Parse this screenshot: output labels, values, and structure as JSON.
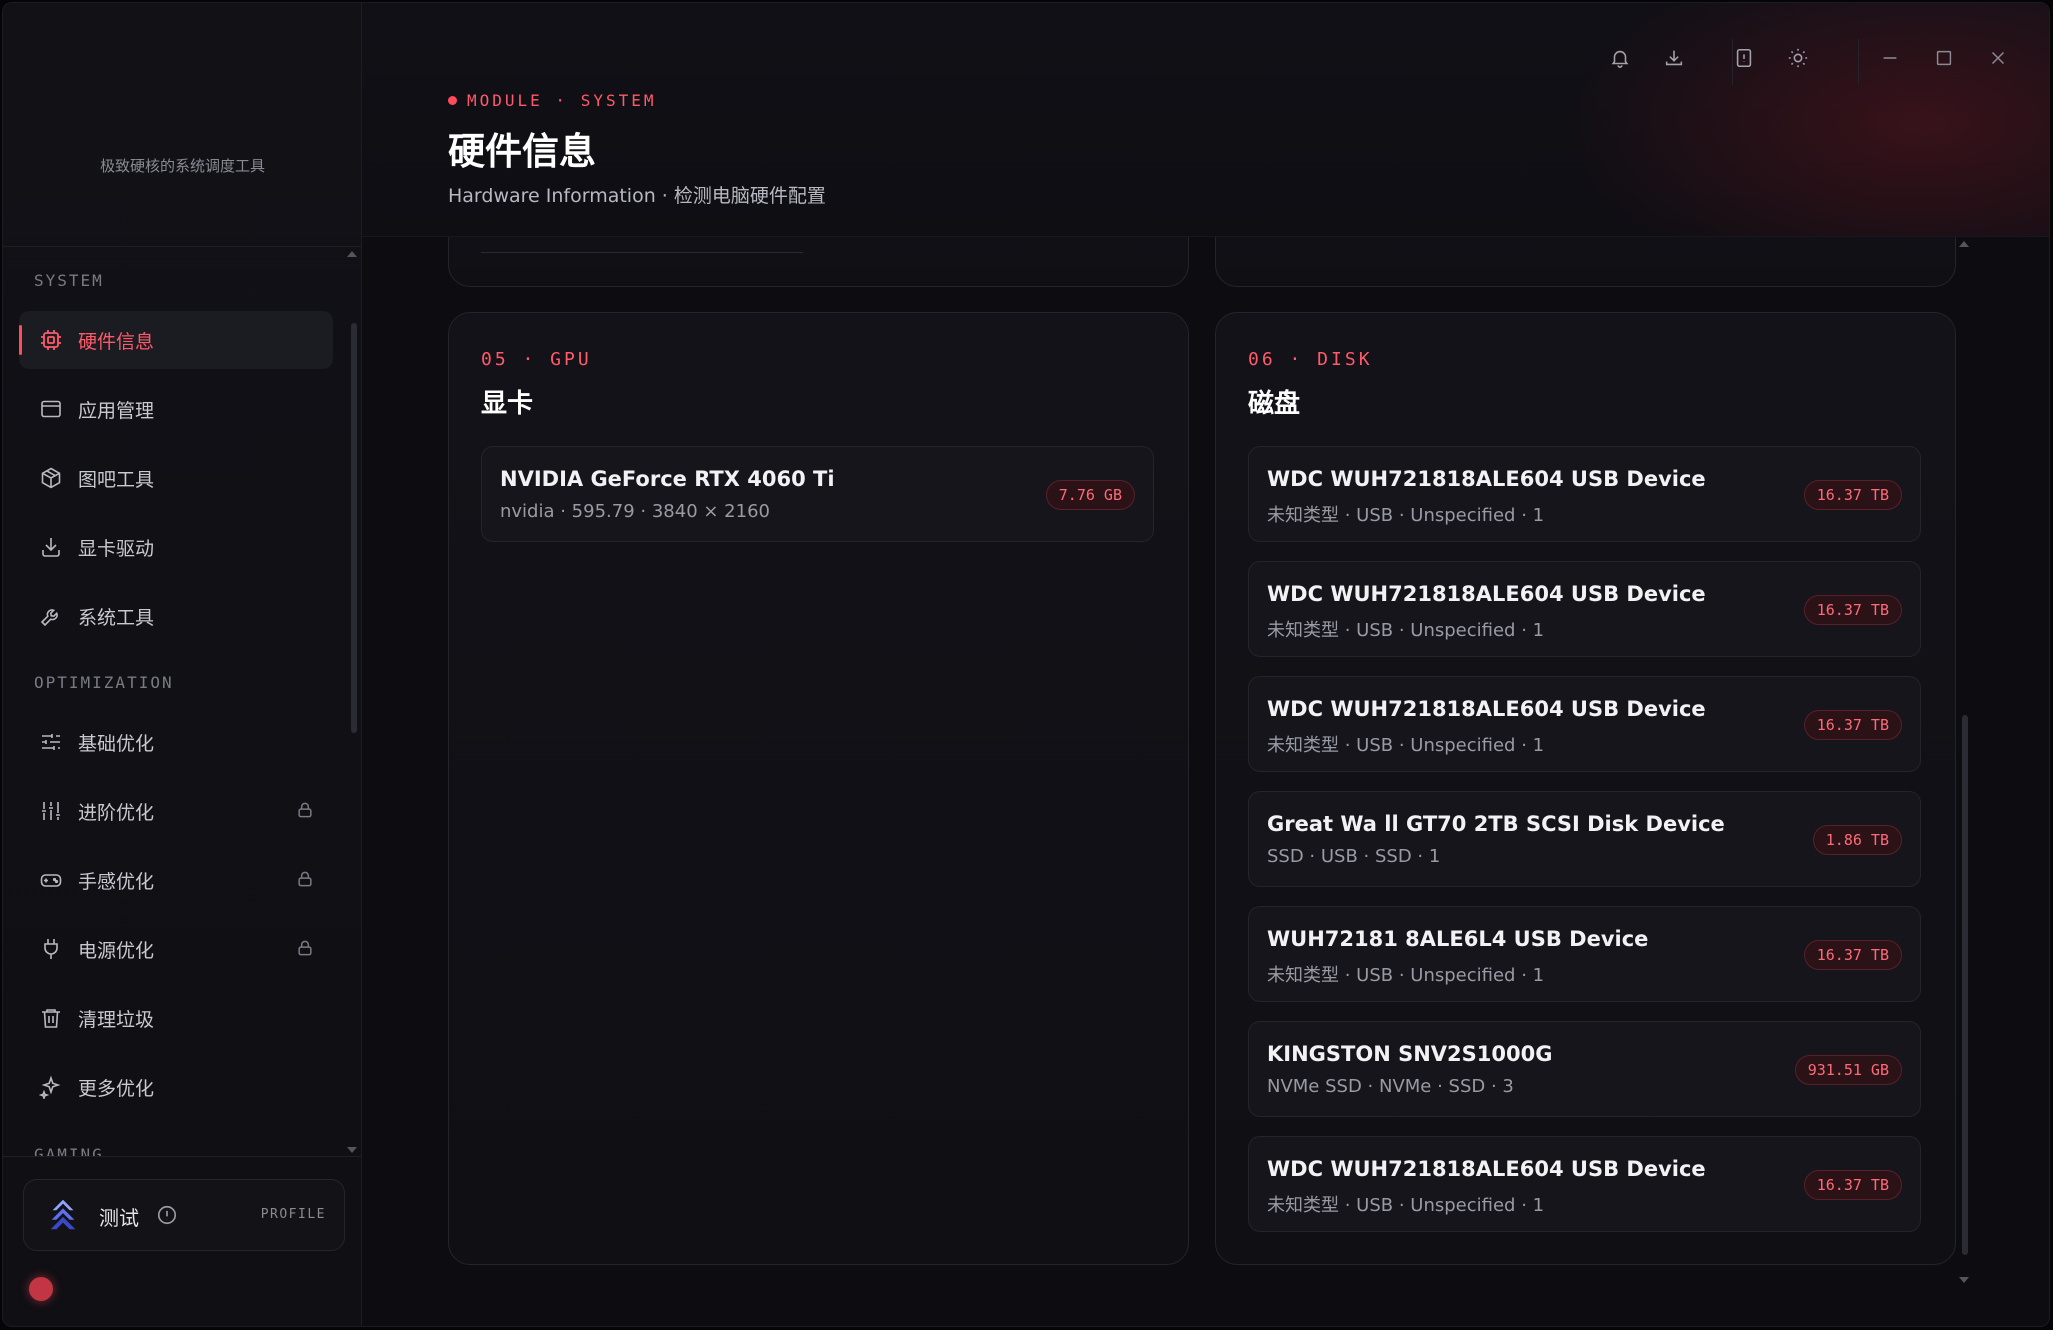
{
  "sidebar": {
    "brand_subtitle": "极致硬核的系统调度工具",
    "sections": {
      "system": "SYSTEM",
      "optimization": "OPTIMIZATION",
      "gaming": "GAMING"
    },
    "items": [
      {
        "label": "硬件信息",
        "icon": "cpu-chip-icon",
        "active": true,
        "locked": false
      },
      {
        "label": "应用管理",
        "icon": "app-window-icon",
        "active": false,
        "locked": false
      },
      {
        "label": "图吧工具",
        "icon": "package-box-icon",
        "active": false,
        "locked": false
      },
      {
        "label": "显卡驱动",
        "icon": "download-icon",
        "active": false,
        "locked": false
      },
      {
        "label": "系统工具",
        "icon": "wrench-icon",
        "active": false,
        "locked": false
      },
      {
        "label": "基础优化",
        "icon": "sliders-horizontal-icon",
        "active": false,
        "locked": false
      },
      {
        "label": "进阶优化",
        "icon": "sliders-vertical-icon",
        "active": false,
        "locked": true
      },
      {
        "label": "手感优化",
        "icon": "gamepad-icon",
        "active": false,
        "locked": true
      },
      {
        "label": "电源优化",
        "icon": "power-plug-icon",
        "active": false,
        "locked": true
      },
      {
        "label": "清理垃圾",
        "icon": "trash-icon",
        "active": false,
        "locked": false
      },
      {
        "label": "更多优化",
        "icon": "sparkles-icon",
        "active": false,
        "locked": false
      }
    ],
    "profile": {
      "name": "测试",
      "tag": "PROFILE"
    }
  },
  "header": {
    "module_tag": "MODULE · SYSTEM",
    "title": "硬件信息",
    "subtitle": "Hardware Information · 检测电脑硬件配置"
  },
  "window_controls": [
    "bell-icon",
    "download-icon",
    "info-square-icon",
    "sun-icon",
    "minimize-icon",
    "maximize-icon",
    "close-icon"
  ],
  "gpu_card": {
    "kicker": "05 · GPU",
    "title": "显卡",
    "items": [
      {
        "name": "NVIDIA GeForce RTX 4060 Ti",
        "meta": "nvidia · 595.79 · 3840 × 2160",
        "badge": "7.76 GB"
      }
    ]
  },
  "disk_card": {
    "kicker": "06 · DISK",
    "title": "磁盘",
    "items": [
      {
        "name": "WDC WUH721818ALE604 USB Device",
        "meta": "未知类型 · USB · Unspecified · 1",
        "badge": "16.37 TB"
      },
      {
        "name": "WDC WUH721818ALE604 USB Device",
        "meta": "未知类型 · USB · Unspecified · 1",
        "badge": "16.37 TB"
      },
      {
        "name": "WDC WUH721818ALE604 USB Device",
        "meta": "未知类型 · USB · Unspecified · 1",
        "badge": "16.37 TB"
      },
      {
        "name": "Great Wa ll GT70 2TB SCSI Disk Device",
        "meta": "SSD · USB · SSD · 1",
        "badge": "1.86 TB"
      },
      {
        "name": "WUH72181 8ALE6L4 USB Device",
        "meta": "未知类型 · USB · Unspecified · 1",
        "badge": "16.37 TB"
      },
      {
        "name": "KINGSTON SNV2S1000G",
        "meta": "NVMe SSD · NVMe · SSD · 3",
        "badge": "931.51 GB"
      },
      {
        "name": "WDC WUH721818ALE604 USB Device",
        "meta": "未知类型 · USB · Unspecified · 1",
        "badge": "16.37 TB"
      }
    ]
  },
  "colors": {
    "accent": "#ff4b5c",
    "background": "#0c0c11",
    "sidebar": "#111116"
  }
}
